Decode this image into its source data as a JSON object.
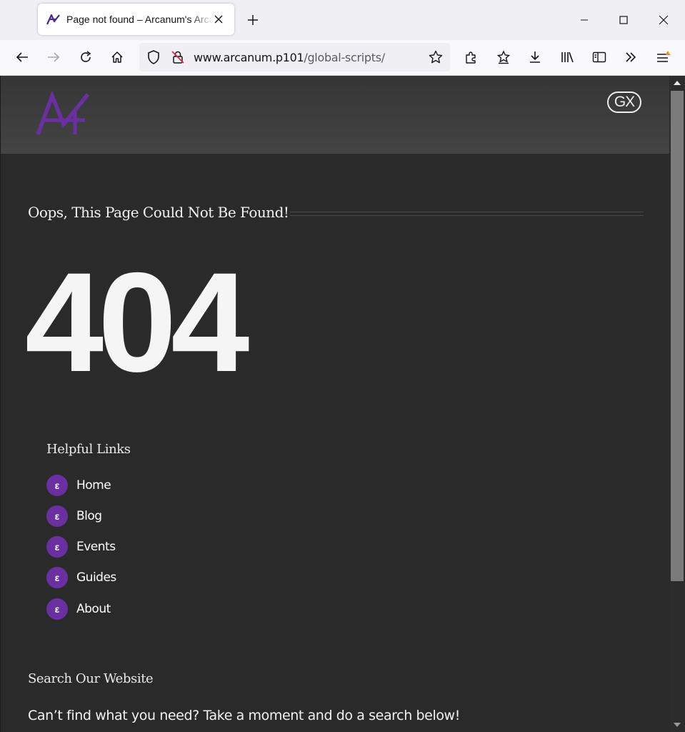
{
  "browser": {
    "tab": {
      "title": "Page not found – Arcanum's Arcanum"
    },
    "url": {
      "host": "www.arcanum.p101",
      "path": "/global-scripts/"
    }
  },
  "site": {
    "badge": "GX"
  },
  "page": {
    "error_title": "Oops, This Page Could Not Be Found!",
    "error_code": "404",
    "helpful_links": {
      "title": "Helpful Links",
      "bullet_glyph": "ε",
      "items": [
        {
          "label": "Home"
        },
        {
          "label": "Blog"
        },
        {
          "label": "Events"
        },
        {
          "label": "Guides"
        },
        {
          "label": "About"
        }
      ]
    },
    "search": {
      "title": "Search Our Website",
      "description": "Can’t find what you need? Take a moment and do a search below!"
    }
  },
  "colors": {
    "brand_purple": "#6a2fa1",
    "page_background": "#2a2a2a"
  }
}
